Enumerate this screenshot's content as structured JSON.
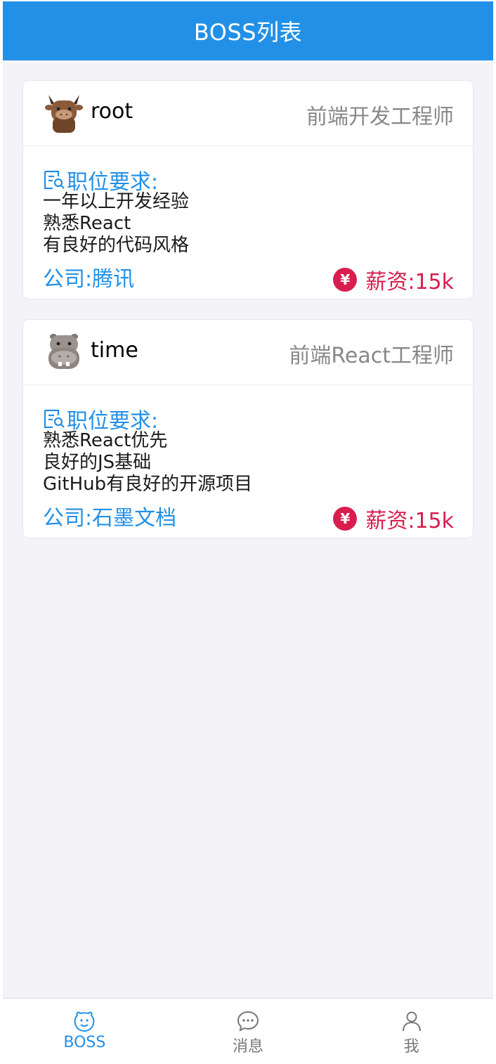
{
  "navbar": {
    "title": "BOSS列表"
  },
  "cards": [
    {
      "username": "root",
      "avatar_icon": "bull-avatar-icon",
      "position": "前端开发工程师",
      "requirements_title": "职位要求:",
      "requirements": [
        "一年以上开发经验",
        "熟悉React",
        "有良好的代码风格"
      ],
      "company": "公司:腾讯",
      "salary": "薪资:15k"
    },
    {
      "username": "time",
      "avatar_icon": "hippo-avatar-icon",
      "position": "前端React工程师",
      "requirements_title": "职位要求:",
      "requirements": [
        "熟悉React优先",
        "良好的JS基础",
        "GitHub有良好的开源项目"
      ],
      "company": "公司:石墨文档",
      "salary": "薪资:15k"
    }
  ],
  "tabbar": {
    "items": [
      {
        "label": "BOSS",
        "icon": "boss-face-icon",
        "active": true
      },
      {
        "label": "消息",
        "icon": "message-bubble-icon",
        "active": false
      },
      {
        "label": "我",
        "icon": "user-icon",
        "active": false
      }
    ]
  },
  "colors": {
    "brand": "#2290e7",
    "salary": "#d81e4f",
    "background": "#f4f4f8"
  }
}
